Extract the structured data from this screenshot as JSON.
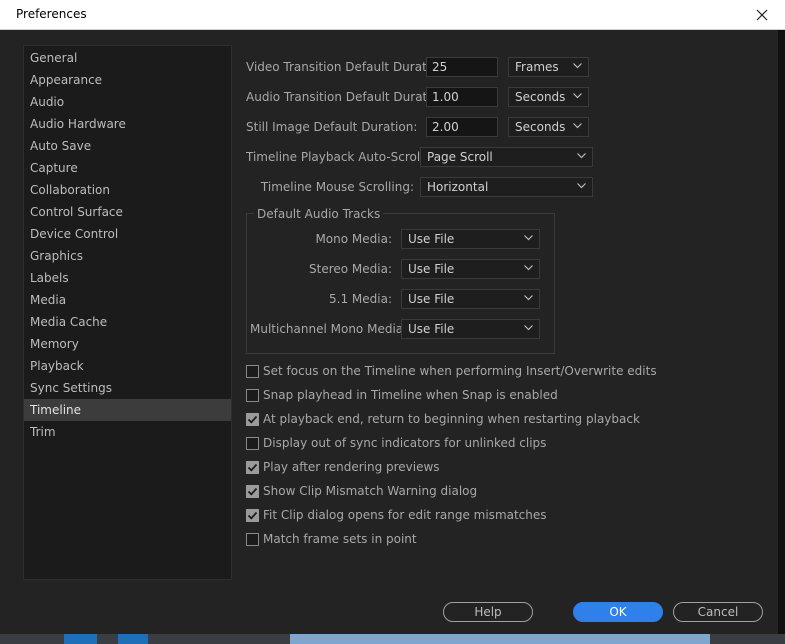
{
  "window": {
    "title": "Preferences"
  },
  "sidebar": {
    "items": [
      {
        "label": "General"
      },
      {
        "label": "Appearance"
      },
      {
        "label": "Audio"
      },
      {
        "label": "Audio Hardware"
      },
      {
        "label": "Auto Save"
      },
      {
        "label": "Capture"
      },
      {
        "label": "Collaboration"
      },
      {
        "label": "Control Surface"
      },
      {
        "label": "Device Control"
      },
      {
        "label": "Graphics"
      },
      {
        "label": "Labels"
      },
      {
        "label": "Media"
      },
      {
        "label": "Media Cache"
      },
      {
        "label": "Memory"
      },
      {
        "label": "Playback"
      },
      {
        "label": "Sync Settings"
      },
      {
        "label": "Timeline"
      },
      {
        "label": "Trim"
      }
    ],
    "selected": "Timeline"
  },
  "durations": {
    "video": {
      "label": "Video Transition Default Duration:",
      "value": "25",
      "unit": "Frames"
    },
    "audio": {
      "label": "Audio Transition Default Duration:",
      "value": "1.00",
      "unit": "Seconds"
    },
    "still": {
      "label": "Still Image Default Duration:",
      "value": "2.00",
      "unit": "Seconds"
    }
  },
  "scrolling": {
    "playback": {
      "label": "Timeline Playback Auto-Scrolling:",
      "value": "Page Scroll"
    },
    "mouse": {
      "label": "Timeline Mouse Scrolling:",
      "value": "Horizontal"
    }
  },
  "audio_tracks": {
    "title": "Default Audio Tracks",
    "mono": {
      "label": "Mono Media:",
      "value": "Use File"
    },
    "stereo": {
      "label": "Stereo Media:",
      "value": "Use File"
    },
    "surround": {
      "label": "5.1 Media:",
      "value": "Use File"
    },
    "multichannel": {
      "label": "Multichannel Mono Media:",
      "value": "Use File"
    }
  },
  "options": [
    {
      "label": "Set focus on the Timeline when performing Insert/Overwrite edits",
      "checked": false
    },
    {
      "label": "Snap playhead in Timeline when Snap is enabled",
      "checked": false
    },
    {
      "label": "At playback end, return to beginning when restarting playback",
      "checked": true
    },
    {
      "label": "Display out of sync indicators for unlinked clips",
      "checked": false
    },
    {
      "label": "Play after rendering previews",
      "checked": true
    },
    {
      "label": "Show Clip Mismatch Warning dialog",
      "checked": true
    },
    {
      "label": "Fit Clip dialog opens for edit range mismatches",
      "checked": true
    },
    {
      "label": "Match frame sets in point",
      "checked": false
    }
  ],
  "buttons": {
    "help": "Help",
    "ok": "OK",
    "cancel": "Cancel"
  },
  "colors": {
    "accent": "#2f80e8",
    "panel": "#232323",
    "selected": "#3c3c3c"
  }
}
